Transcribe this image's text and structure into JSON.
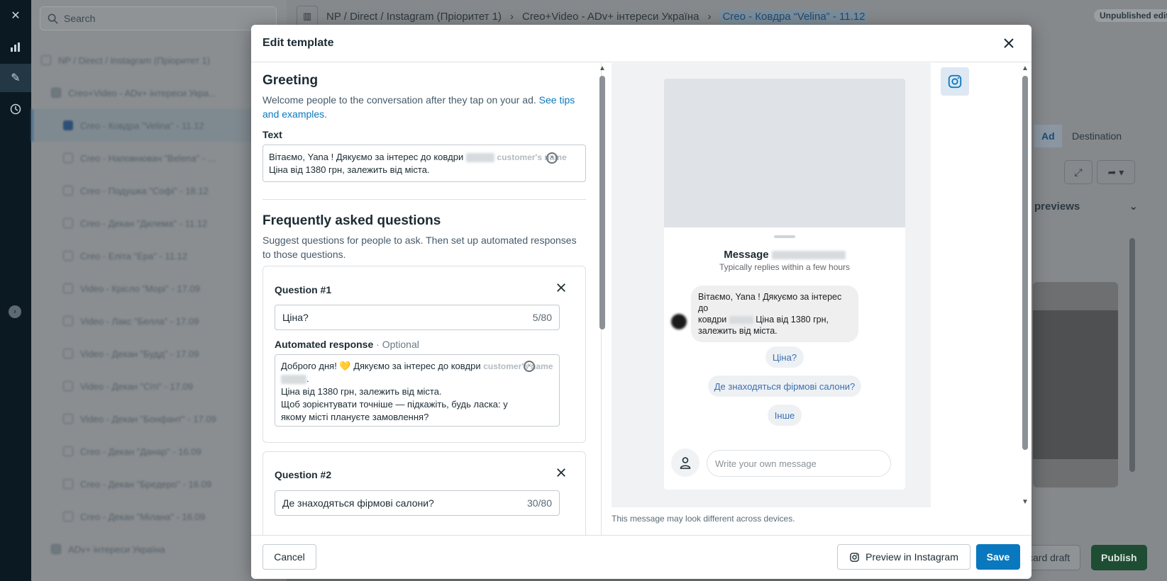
{
  "background": {
    "search_placeholder": "Search",
    "breadcrumbs": [
      "NP / Direct / Instagram (Пріоритет 1)",
      "Creo+Video - ADv+ інтереси Україна",
      "Creo - Ковдра “Velina” - 11.12"
    ],
    "status_badge": "Unpublished edit",
    "tree": [
      "NP / Direct / Instagram (Пріоритет 1)",
      "Creo+Video - ADv+ інтереси Укра...",
      "Creo - Ковдра \"Velina\" - 11.12",
      "Creo - Наповнювач \"Belena\" - ...",
      "Creo - Подушка \"Софі\" - 18.12",
      "Creo - Декан \"Дилема\" - 11.12",
      "Creo - Еліта \"Ера\" - 11.12",
      "Video - Крісло \"Морі\" - 17.09",
      "Video - Лакс \"Белла\" - 17.09",
      "Video - Декан \"Будд\" - 17.09",
      "Video - Декан \"Сіті\" - 17.09",
      "Video - Декан \"Бонфант\" - 17.09",
      "Creo - Декан \"Данар\" - 16.09",
      "Creo - Декан \"Бредеро\" - 16.09",
      "Creo - Декан \"Мілана\" - 16.09",
      "ADv+ інтереси Україна"
    ],
    "right_tabs": {
      "ad": "Ad",
      "destination": "Destination"
    },
    "previews_label": "previews",
    "discard_label": "card draft",
    "publish_label": "Publish"
  },
  "modal": {
    "title": "Edit template",
    "greeting": {
      "title": "Greeting",
      "description": "Welcome people to the conversation after they tap on your ad.",
      "link": "See tips and examples.",
      "text_label": "Text",
      "text_line1": "Вітаємо, Yana ! Дякуємо за інтерес до ковдри",
      "text_line2": "Ціна від 1380 грн, залежить від міста.",
      "placeholder_tag": "customer's name"
    },
    "faq": {
      "title": "Frequently asked questions",
      "description": "Suggest questions for people to ask. Then set up automated responses to those questions.",
      "q1": {
        "title": "Question #1",
        "value": "Ціна?",
        "count": "5/80",
        "response_label": "Automated response",
        "optional": "· Optional",
        "response_line1": "Доброго дня! 💛 Дякуємо за інтерес до ковдри",
        "response_line3": "Ціна від 1380 грн, залежить від міста.",
        "response_line4": "Щоб зорієнтувати точніше — підкажіть, будь ласка: у якому місті плануєте замовлення?",
        "placeholder_tag": "customer's name"
      },
      "q2": {
        "title": "Question #2",
        "value": "Де знаходяться фірмові салони?",
        "count": "30/80"
      }
    },
    "preview": {
      "message_title": "Message",
      "replies_note": "Typically replies within a few hours",
      "bubble_line1": "Вітаємо, Yana ! Дякуємо за інтерес до",
      "bubble_line2a": "ковдри",
      "bubble_line2b": "Ціна від 1380 грн,",
      "bubble_line3": "залежить від міста.",
      "chips": [
        "Ціна?",
        "Де знаходяться фірмові салони?",
        "Інше"
      ],
      "own_message_placeholder": "Write your own message",
      "device_note": "This message may look different across devices."
    },
    "footer": {
      "cancel": "Cancel",
      "preview_instagram": "Preview in Instagram",
      "save": "Save"
    }
  },
  "colors": {
    "accent": "#0a78be",
    "publish": "#1e4d33"
  },
  "icons": [
    "close-icon",
    "search-icon",
    "chart-icon",
    "pencil-icon",
    "clock-icon",
    "instagram-icon",
    "user-icon"
  ]
}
